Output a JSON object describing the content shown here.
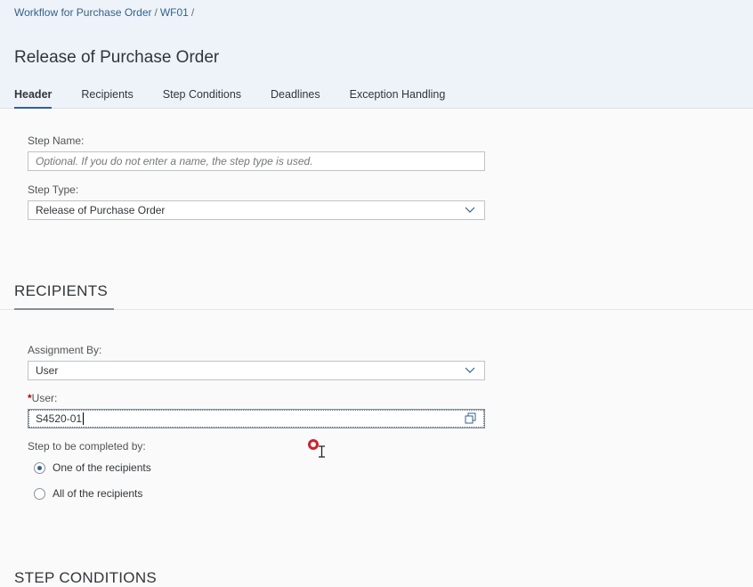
{
  "breadcrumb": {
    "items": [
      "Workflow for Purchase Order",
      "WF01"
    ],
    "separator": "/"
  },
  "page_title": "Release of Purchase Order",
  "tabs": [
    {
      "label": "Header",
      "active": true
    },
    {
      "label": "Recipients",
      "active": false
    },
    {
      "label": "Step Conditions",
      "active": false
    },
    {
      "label": "Deadlines",
      "active": false
    },
    {
      "label": "Exception Handling",
      "active": false
    }
  ],
  "header_section": {
    "step_name": {
      "label": "Step Name:",
      "value": "",
      "placeholder": "Optional. If you do not enter a name, the step type is used."
    },
    "step_type": {
      "label": "Step Type:",
      "value": "Release of Purchase Order"
    }
  },
  "recipients_section": {
    "title": "RECIPIENTS",
    "assignment_by": {
      "label": "Assignment By:",
      "value": "User"
    },
    "user": {
      "required_marker": "*",
      "label": "User:",
      "value": "S4520-01",
      "icon": "value-help-icon"
    },
    "completion": {
      "label": "Step to be completed by:",
      "options": [
        {
          "label": "One of the recipients",
          "selected": true
        },
        {
          "label": "All of the recipients",
          "selected": false
        }
      ]
    }
  },
  "step_conditions_section": {
    "title": "STEP CONDITIONS"
  },
  "colors": {
    "accent": "#346187",
    "required": "#bb0000",
    "header_bg": "#eef3fa",
    "cursor_ring": "#d0202e"
  }
}
